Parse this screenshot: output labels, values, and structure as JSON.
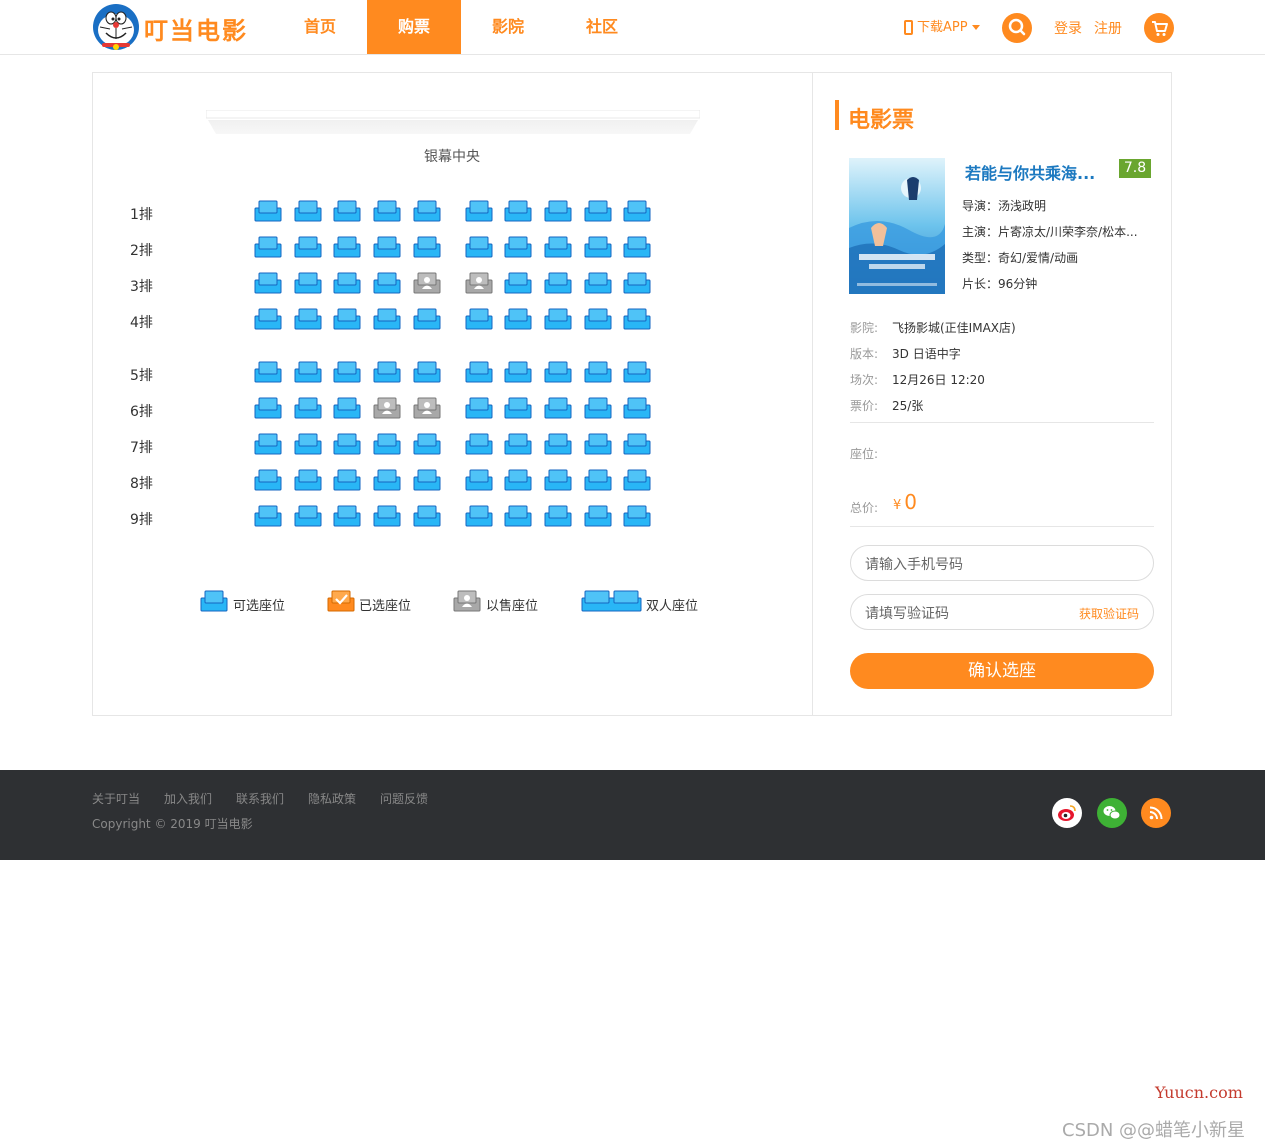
{
  "colors": {
    "accent": "#ff8a1f",
    "seat_available": "#29b6f6",
    "seat_sold": "#a8a8a8",
    "rating_bg": "#6aa62f",
    "footer_bg": "#2e3033",
    "title_blue": "#1c79c0"
  },
  "header": {
    "logo_text": "叮当电影",
    "nav": [
      {
        "label": "首页",
        "active": false
      },
      {
        "label": "购票",
        "active": true
      },
      {
        "label": "影院",
        "active": false
      },
      {
        "label": "社区",
        "active": false
      }
    ],
    "download_app": "下载APP",
    "login": "登录",
    "register": "注册",
    "icons": {
      "phone": "phone-icon",
      "search": "search-icon",
      "cart": "cart-icon"
    }
  },
  "hall": {
    "screen_label": "银幕中央",
    "rows": [
      {
        "label": "1排",
        "sold": []
      },
      {
        "label": "2排",
        "sold": []
      },
      {
        "label": "3排",
        "sold": [
          4,
          5
        ]
      },
      {
        "label": "4排",
        "sold": []
      },
      {
        "label": "5排",
        "sold": []
      },
      {
        "label": "6排",
        "sold": [
          3,
          4
        ]
      },
      {
        "label": "7排",
        "sold": []
      },
      {
        "label": "8排",
        "sold": []
      },
      {
        "label": "9排",
        "sold": []
      }
    ],
    "seats_per_row": 10,
    "legend": {
      "available": "可选座位",
      "selected": "已选座位",
      "sold": "以售座位",
      "couple": "双人座位"
    }
  },
  "ticket": {
    "title": "电影票",
    "movie": {
      "name": "若能与你共乘海...",
      "rating": "7.8",
      "director_label": "导演：",
      "director": "汤浅政明",
      "cast_label": "主演：",
      "cast": "片寄凉太/川荣李奈/松本...",
      "genre_label": "类型：",
      "genre": "奇幻/爱情/动画",
      "duration_label": "片长：",
      "duration": "96分钟"
    },
    "info": {
      "cinema_label": "影院:",
      "cinema": "飞扬影城(正佳IMAX店)",
      "version_label": "版本:",
      "version": "3D 日语中字",
      "session_label": "场次:",
      "session": "12月26日 12:20",
      "price_label": "票价:",
      "price": "25/张"
    },
    "seats_label": "座位:",
    "total_label": "总价:",
    "currency": "¥",
    "total": "0",
    "phone_placeholder": "请输入手机号码",
    "code_placeholder": "请填写验证码",
    "get_code": "获取验证码",
    "confirm": "确认选座"
  },
  "footer": {
    "links": [
      "关于叮当",
      "加入我们",
      "联系我们",
      "隐私政策",
      "问题反馈"
    ],
    "copyright": "Copyright © 2019 叮当电影",
    "social": [
      "weibo-icon",
      "wechat-icon",
      "rss-icon"
    ]
  },
  "watermarks": {
    "site": "Yuucn.com",
    "author": "CSDN @@蜡笔小新星"
  }
}
